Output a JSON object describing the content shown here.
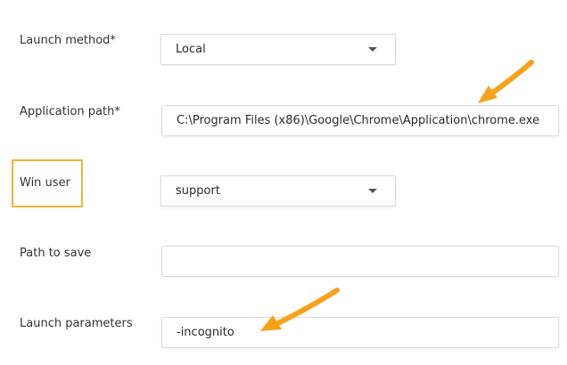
{
  "form": {
    "launch_method": {
      "label": "Launch method*",
      "value": "Local"
    },
    "application_path": {
      "label": "Application path*",
      "value": "C:\\Program Files (x86)\\Google\\Chrome\\Application\\chrome.exe"
    },
    "win_user": {
      "label": "Win user",
      "value": "support"
    },
    "path_to_save": {
      "label": "Path to save",
      "value": ""
    },
    "launch_parameters": {
      "label": "Launch parameters",
      "value": "-incognito"
    }
  },
  "annotations": {
    "arrow_color": "#f7a21b",
    "highlight_color": "#f2b233"
  },
  "icons": {
    "dropdown": "chevron-down-icon",
    "annotation_arrow": "arrow-icon"
  }
}
